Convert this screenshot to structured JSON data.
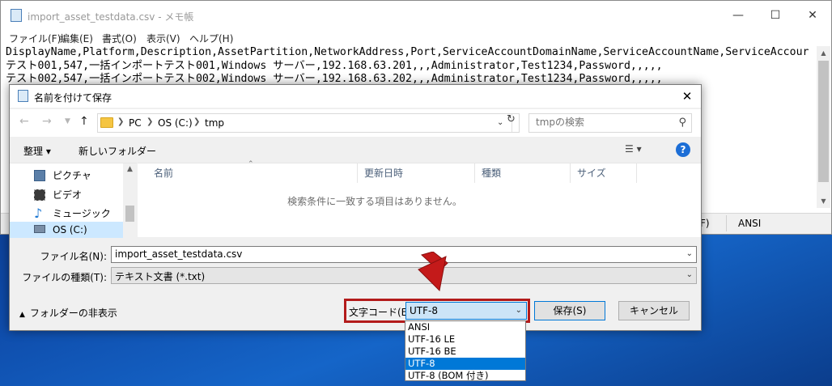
{
  "notepad": {
    "title": "import_asset_testdata.csv - メモ帳",
    "menu": [
      "ファイル(F)",
      "編集(E)",
      "書式(O)",
      "表示(V)",
      "ヘルプ(H)"
    ],
    "lines": [
      "DisplayName,Platform,Description,AssetPartition,NetworkAddress,Port,ServiceAccountDomainName,ServiceAccountName,ServiceAccour",
      "テスト001,547,一括インポートテスト001,Windows サーバー,192.168.63.201,,,Administrator,Test1234,Password,,,,,",
      "テスト002,547,一括インポートテスト002,Windows サーバー,192.168.63.202,,,Administrator,Test1234,Password,,,,,"
    ],
    "status_line_fragment": "F)",
    "status_encoding": "ANSI"
  },
  "dialog": {
    "title": "名前を付けて保存",
    "breadcrumb": [
      "PC",
      "OS (C:)",
      "tmp"
    ],
    "search_placeholder": "tmpの検索",
    "organize_label": "整理 ▾",
    "new_folder_label": "新しいフォルダー",
    "nav_items": [
      "ピクチャ",
      "ビデオ",
      "ミュージック",
      "OS (C:)"
    ],
    "columns": [
      "名前",
      "更新日時",
      "種類",
      "サイズ"
    ],
    "empty_message": "検索条件に一致する項目はありません。",
    "filename_label": "ファイル名(N):",
    "filename_value": "import_asset_testdata.csv",
    "filetype_label": "ファイルの種類(T):",
    "filetype_value": "テキスト文書 (*.txt)",
    "hide_folders_label": "フォルダーの非表示",
    "encoding_label": "文字コード(E):",
    "encoding_value": "UTF-8",
    "save_label": "保存(S)",
    "cancel_label": "キャンセル",
    "encoding_options": [
      "ANSI",
      "UTF-16 LE",
      "UTF-16 BE",
      "UTF-8",
      "UTF-8 (BOM 付き)"
    ],
    "encoding_selected_index": 3
  },
  "colors": {
    "highlight_red": "#b31b1b",
    "selection_blue": "#0078d7"
  }
}
